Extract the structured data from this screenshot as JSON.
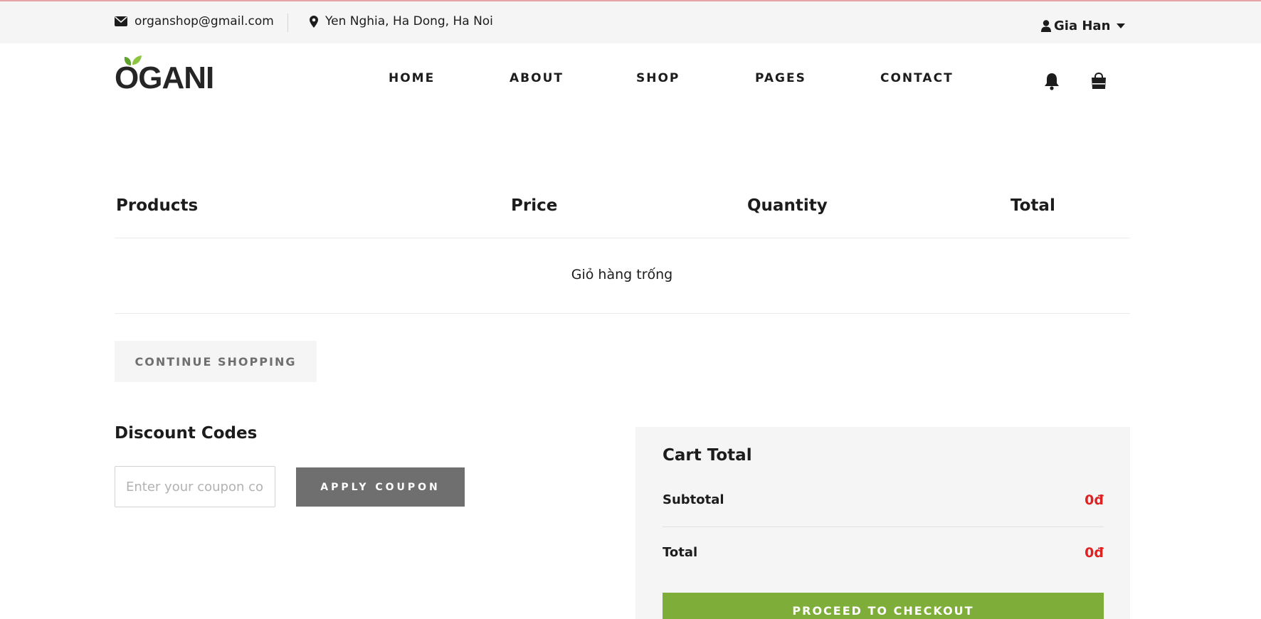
{
  "topbar": {
    "email": "organshop@gmail.com",
    "address": "Yen Nghia, Ha Dong, Ha Noi",
    "user_name": "Gia Han",
    "icons": [
      "envelope-icon",
      "map-marker-icon",
      "user-icon",
      "caret-down-icon"
    ]
  },
  "header": {
    "logo_text": "OGANI",
    "nav": [
      "HOME",
      "ABOUT",
      "SHOP",
      "PAGES",
      "CONTACT"
    ],
    "icons": [
      "bell-icon",
      "shopping-bag-icon"
    ]
  },
  "cart": {
    "columns": [
      "Products",
      "Price",
      "Quantity",
      "Total"
    ],
    "empty_message": "Giỏ hàng trống",
    "continue_label": "CONTINUE SHOPPING"
  },
  "discount": {
    "title": "Discount Codes",
    "placeholder": "Enter your coupon code",
    "apply_label": "APPLY COUPON"
  },
  "cart_total": {
    "title": "Cart Total",
    "subtotal_label": "Subtotal",
    "subtotal_value": "0đ",
    "total_label": "Total",
    "total_value": "0đ",
    "checkout_label": "PROCEED TO CHECKOUT"
  },
  "colors": {
    "accent_green": "#7fad39",
    "price_red": "#dd2222",
    "gray_button": "#6f6f6f",
    "panel_bg": "#f5f5f5"
  }
}
